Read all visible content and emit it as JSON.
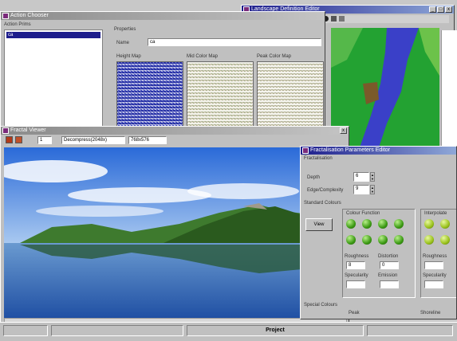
{
  "landscape_editor": {
    "title": "Landscape Definition Editor"
  },
  "action_chooser": {
    "title": "Action Chooser",
    "left_label": "Action Prims",
    "list_item": "ca",
    "properties_label": "Properties",
    "name_label": "Name",
    "name_value": "ca",
    "height_map_label": "Height Map",
    "mid_color_label": "Mid Color Map",
    "peak_color_label": "Peak Color Map"
  },
  "fractal_viewer": {
    "title": "Fractal Viewer",
    "frame_value": "1",
    "dropdown": "Decompress(2048x)",
    "readout": "768x576"
  },
  "params_editor": {
    "title": "Fractalisation Parameters Editor",
    "fractalisation_label": "Fractalisation",
    "depth_label": "Depth",
    "depth_value": "6",
    "edge_label": "Edge/Complexity",
    "edge_value": "9",
    "std_colours_label": "Standard Colours",
    "colour_function_label": "Colour Function",
    "interpolate_label": "Interpolate",
    "view_button": "View",
    "roughness_label": "Roughness",
    "distortion_label": "Distortion",
    "roughness_value": "8",
    "distortion_value": "0",
    "specularity_label": "Specularity",
    "emission_label": "Emission",
    "special_colours_label": "Special Colours",
    "peak_label": "Peak",
    "shoreline_label": "Shoreline"
  },
  "statusbar": {
    "project": "Project"
  },
  "colors": {
    "title_active": "#1d1d8c",
    "sea": "#3a40c8",
    "land": "#2e9a2e"
  }
}
